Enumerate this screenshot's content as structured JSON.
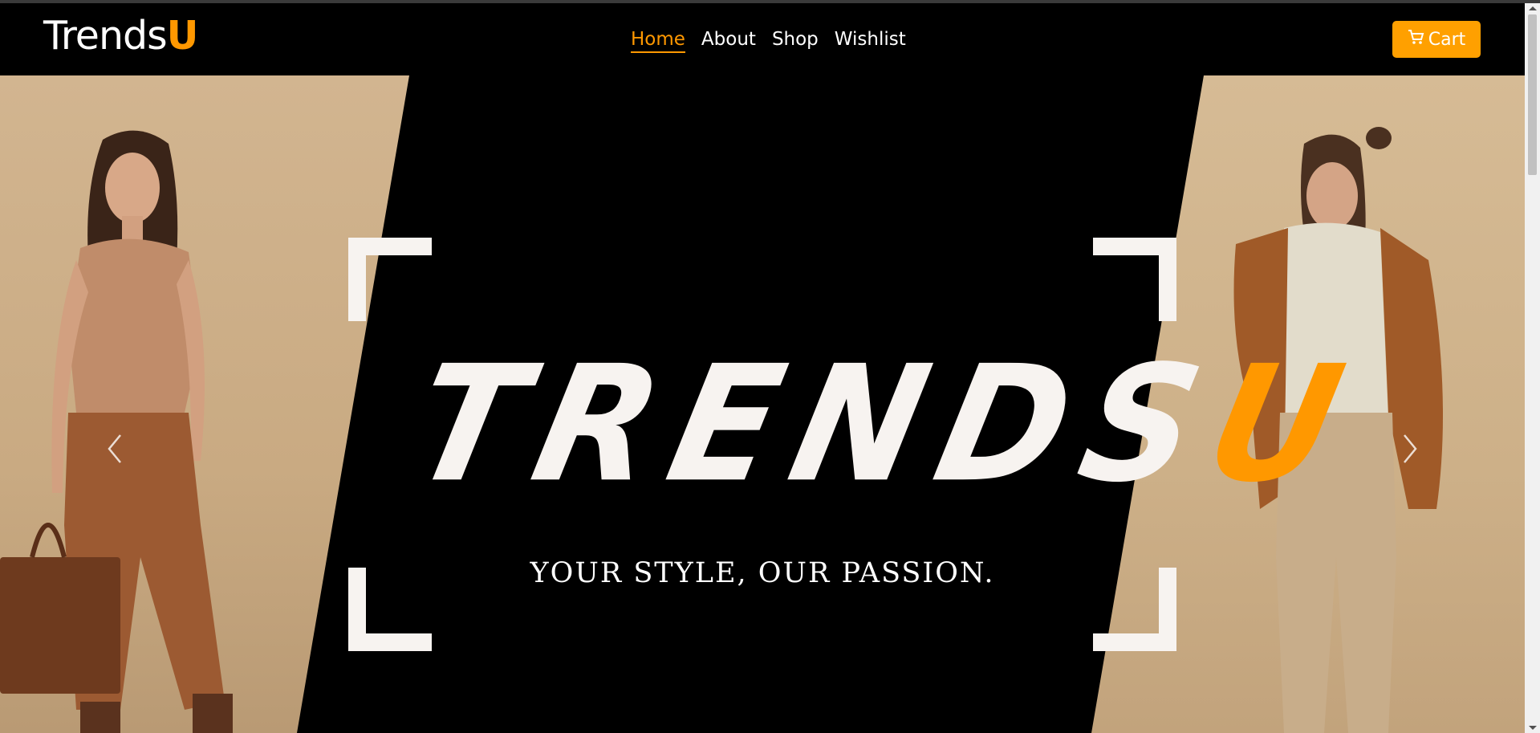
{
  "brand": {
    "text_main": "Trends",
    "text_accent": "U"
  },
  "nav": {
    "items": [
      {
        "label": "Home",
        "active": true
      },
      {
        "label": "About",
        "active": false
      },
      {
        "label": "Shop",
        "active": false
      },
      {
        "label": "Wishlist",
        "active": false
      }
    ]
  },
  "cart": {
    "label": "Cart",
    "icon": "cart-icon"
  },
  "hero": {
    "title_main": "TRENDS",
    "title_accent": "U",
    "tagline": "YOUR STYLE, OUR PASSION.",
    "prev_icon": "chevron-left-icon",
    "next_icon": "chevron-right-icon"
  },
  "colors": {
    "accent": "#ff9800",
    "background": "#000000",
    "text": "#ffffff"
  }
}
